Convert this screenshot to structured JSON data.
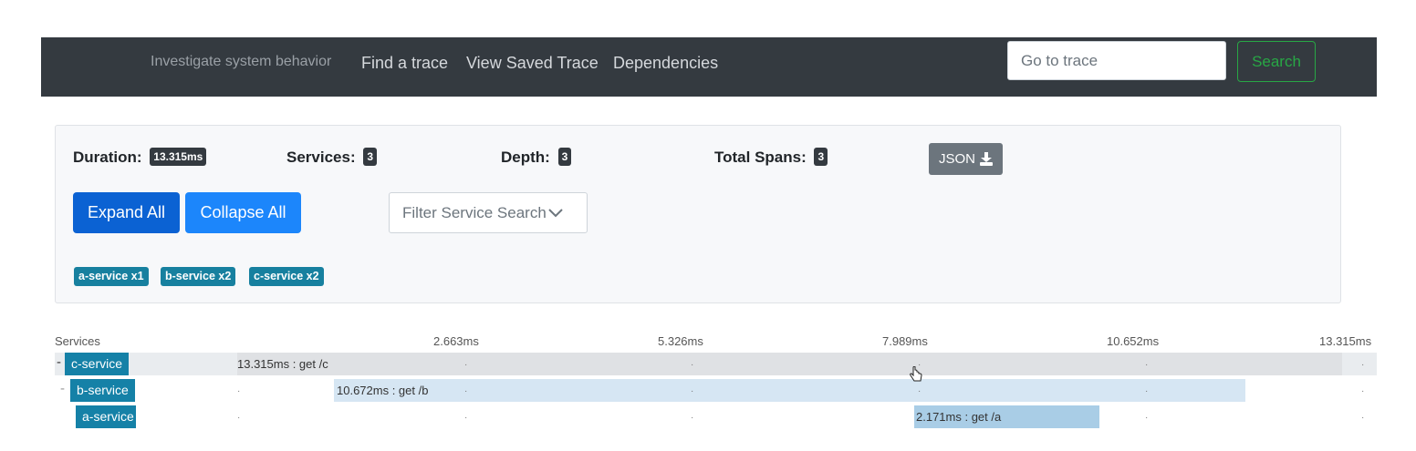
{
  "nav": {
    "tagline": "Investigate system behavior",
    "links": [
      "Find a trace",
      "View Saved Trace",
      "Dependencies"
    ],
    "goto_placeholder": "Go to trace",
    "search_label": "Search"
  },
  "summary": {
    "duration_label": "Duration:",
    "duration_value": "13.315ms",
    "services_label": "Services:",
    "services_value": "3",
    "depth_label": "Depth:",
    "depth_value": "3",
    "spans_label": "Total Spans:",
    "spans_value": "3",
    "json_label": "JSON",
    "json_icon": "download-icon",
    "expand_label": "Expand All",
    "collapse_label": "Collapse All",
    "filter_placeholder": "Filter Service Search",
    "tags": [
      "a-service x1",
      "b-service x2",
      "c-service x2"
    ]
  },
  "timeline": {
    "services_header": "Services",
    "ticks": [
      "2.663ms",
      "5.326ms",
      "7.989ms",
      "10.652ms",
      "13.315ms"
    ],
    "rows": [
      {
        "toggle": "-",
        "service": "c-service",
        "span": "13.315ms : get /c",
        "start_ms": 0,
        "duration_ms": 13.315
      },
      {
        "toggle": "-",
        "service": "b-service",
        "span": "10.672ms : get /b",
        "start_ms": 1.0,
        "duration_ms": 10.672
      },
      {
        "toggle": "",
        "service": "a-service",
        "span": "2.171ms : get /a",
        "start_ms": 6.7,
        "duration_ms": 2.171
      }
    ]
  },
  "colors": {
    "navbar": "#343a40",
    "accent_green": "#28a745",
    "expand_blue": "#0b62d3",
    "collapse_blue": "#1c86fb",
    "service_tag": "#17809f",
    "span_bar": [
      "#dfe1e4",
      "#d6e6f3",
      "#a9cde6"
    ]
  }
}
